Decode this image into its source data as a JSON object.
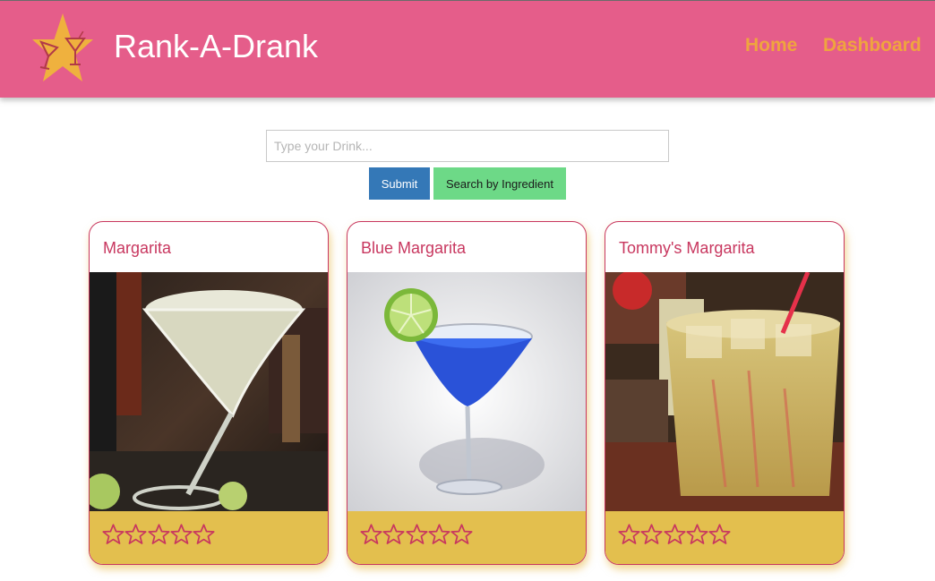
{
  "app": {
    "brand": "Rank-A-Drank",
    "nav": [
      {
        "label": "Home"
      },
      {
        "label": "Dashboard"
      }
    ]
  },
  "search": {
    "placeholder": "Type your Drink...",
    "value": "",
    "submit_label": "Submit",
    "ingredient_label": "Search by Ingredient"
  },
  "colors": {
    "navbar": "#e55d8a",
    "nav_link": "#efa43f",
    "card_accent": "#c8375f",
    "card_footer": "#e3bf4e",
    "submit": "#3478b7",
    "ingredient": "#6dd987"
  },
  "drinks": [
    {
      "name": "Margarita",
      "rating": 0,
      "max_rating": 5,
      "image": "margarita-photo"
    },
    {
      "name": "Blue Margarita",
      "rating": 0,
      "max_rating": 5,
      "image": "blue-margarita-photo"
    },
    {
      "name": "Tommy's Margarita",
      "rating": 0,
      "max_rating": 5,
      "image": "tommys-margarita-photo"
    }
  ]
}
